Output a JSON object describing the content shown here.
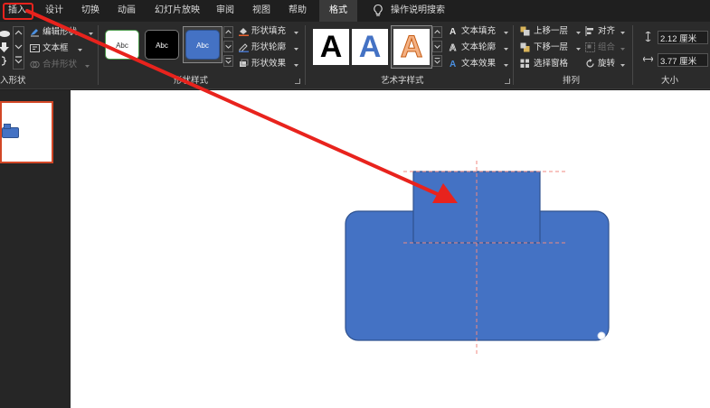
{
  "tabs": {
    "insert": "插入",
    "design": "设计",
    "transitions": "切换",
    "animations": "动画",
    "slideshow": "幻灯片放映",
    "review": "审阅",
    "view": "视图",
    "help": "帮助",
    "format": "格式",
    "tell_me": "操作说明搜索"
  },
  "insert_shapes": {
    "edit_shape": "编辑形状",
    "text_box": "文本框",
    "merge_shapes": "合并形状",
    "group_label": "入形状"
  },
  "shape_styles": {
    "swatch_text": "Abc",
    "shape_fill": "形状填充",
    "shape_outline": "形状轮廓",
    "shape_effects": "形状效果",
    "group_label": "形状样式"
  },
  "wordart": {
    "letter": "A",
    "text_fill": "文本填充",
    "text_outline": "文本轮廓",
    "text_effects": "文本效果",
    "group_label": "艺术字样式"
  },
  "arrange": {
    "bring_forward": "上移一层",
    "send_backward": "下移一层",
    "selection_pane": "选择窗格",
    "align": "对齐",
    "group": "组合",
    "rotate": "旋转",
    "group_label": "排列"
  },
  "size": {
    "height": "2.12 厘米",
    "width": "3.77 厘米",
    "group_label": "大小"
  },
  "colors": {
    "shape_fill": "#4472c4",
    "shape_border": "#2f528f",
    "annotation_red": "#e8231d",
    "ribbon_bg": "#2b2b2b"
  }
}
